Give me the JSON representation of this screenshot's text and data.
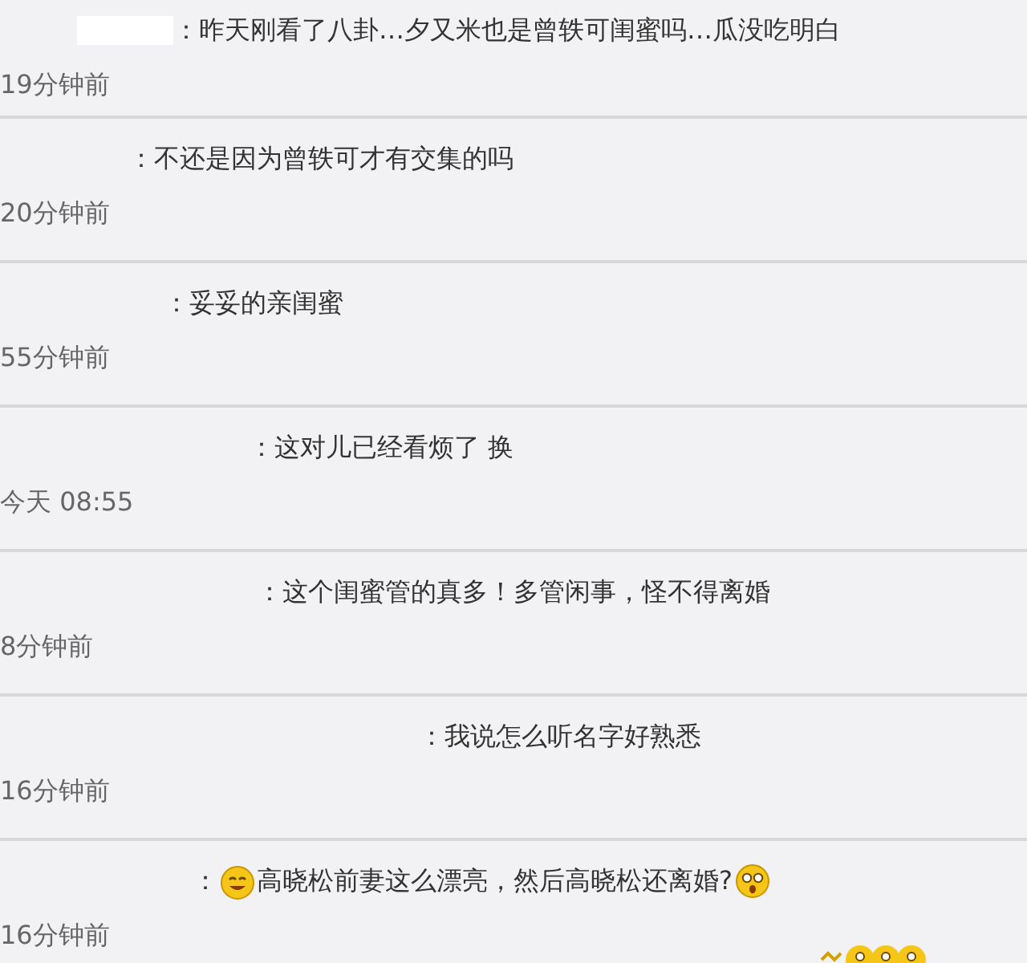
{
  "comments": [
    {
      "text": "：昨天刚看了八卦…夕又米也是曾轶可闺蜜吗…瓜没吃明白",
      "time": "19分钟前",
      "name_hidden": true
    },
    {
      "text": "：不还是因为曾轶可才有交集的吗",
      "time": "20分钟前",
      "name_hidden": false
    },
    {
      "text": "：妥妥的亲闺蜜",
      "time": "55分钟前",
      "name_hidden": false
    },
    {
      "text": "：这对儿已经看烦了 换",
      "time": "今天 08:55",
      "name_hidden": false
    },
    {
      "text": "：这个闺蜜管的真多！多管闲事，怪不得离婚",
      "time": "8分钟前",
      "name_hidden": false
    },
    {
      "text": "：我说怎么听名字好熟悉",
      "time": "16分钟前",
      "name_hidden": false
    },
    {
      "text": "高晓松前妻这么漂亮，然后高晓松还离婚?",
      "prefix": "：",
      "time": "16分钟前",
      "name_hidden": false,
      "leading_emoji": true,
      "trailing_emoji": true,
      "emoji_below": true
    }
  ]
}
